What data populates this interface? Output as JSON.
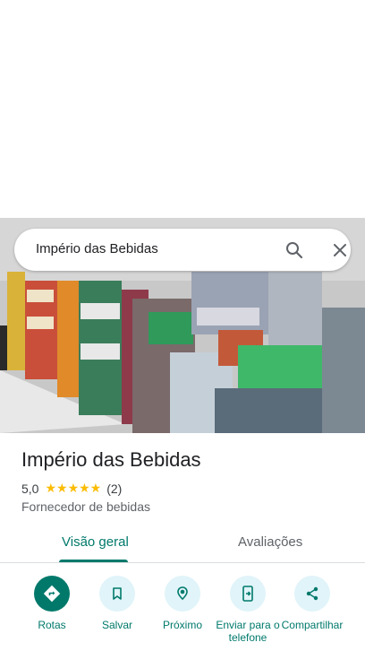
{
  "search": {
    "query": "Império das Bebidas",
    "search_icon": "search-icon",
    "close_icon": "close-icon"
  },
  "place": {
    "name": "Império das Bebidas",
    "rating": "5,0",
    "stars": "★★★★★",
    "review_count": "(2)",
    "category": "Fornecedor de bebidas"
  },
  "tabs": [
    {
      "label": "Visão geral",
      "selected": true
    },
    {
      "label": "Avaliações",
      "selected": false
    }
  ],
  "actions": [
    {
      "label": "Rotas",
      "icon": "directions-icon"
    },
    {
      "label": "Salvar",
      "icon": "bookmark-icon"
    },
    {
      "label": "Próximo",
      "icon": "nearby-icon"
    },
    {
      "label": "Enviar para o telefone",
      "icon": "send-to-phone-icon"
    },
    {
      "label": "Compartilhar",
      "icon": "share-icon"
    }
  ],
  "colors": {
    "accent": "#00796b",
    "action_bg": "#e0f4f9",
    "star": "#fbbc04"
  }
}
